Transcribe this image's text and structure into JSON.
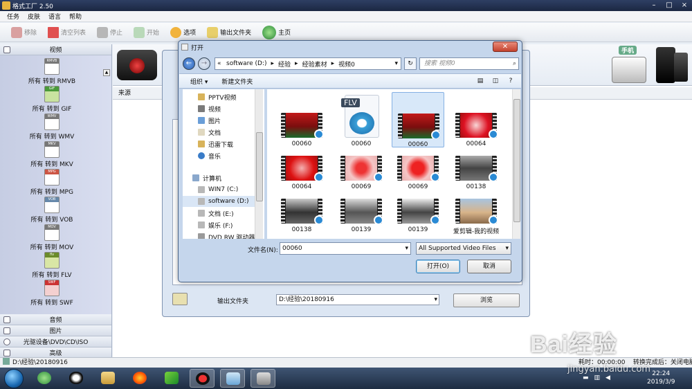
{
  "app": {
    "title": "格式工厂 2.50"
  },
  "colors": {
    "accent": "#2a5fb4",
    "title_bar": "#1b2742",
    "sidebar": "#c6cde3",
    "close": "#c4422e"
  },
  "menu": [
    "任务",
    "皮肤",
    "语言",
    "帮助"
  ],
  "toolbar": {
    "remove": "移除",
    "clear": "清空列表",
    "stop": "停止",
    "start": "开始",
    "options": "选项",
    "output_folder": "输出文件夹",
    "home": "主页"
  },
  "sidebar": {
    "video_header": "视频",
    "formats": [
      {
        "label": "所有 转到 RMVB",
        "tag": "RMVB"
      },
      {
        "label": "所有 转到 GIF",
        "tag": "GIF"
      },
      {
        "label": "所有 转到 WMV",
        "tag": "WMV"
      },
      {
        "label": "所有 转到 MKV",
        "tag": "MKV"
      },
      {
        "label": "所有 转到 MPG",
        "tag": "MPG"
      },
      {
        "label": "所有 转到 VOB",
        "tag": "VOB"
      },
      {
        "label": "所有 转到 MOV",
        "tag": "MOV"
      },
      {
        "label": "所有 转到 FLV",
        "tag": "flv"
      },
      {
        "label": "所有 转到 SWF",
        "tag": "SWF"
      }
    ],
    "audio": "音频",
    "image": "图片",
    "disc": "光驱设备\\DVD\\CD\\ISO",
    "advanced": "高级"
  },
  "main": {
    "source_header": "来源",
    "phone_label": "手机"
  },
  "bg_dialog": {
    "output_folder_label": "输出文件夹",
    "output_path": "D:\\经验\\20180916",
    "browse": "浏览"
  },
  "open_dialog": {
    "title": "打开",
    "path": [
      "software (D:)",
      "经验",
      "经验素材",
      "视频0"
    ],
    "search_placeholder": "搜索 视频0",
    "organize": "组织 ▾",
    "new_folder": "新建文件夹",
    "nav": {
      "favorites": [
        "PPTV视频",
        "视频",
        "图片",
        "文档",
        "迅雷下载",
        "音乐"
      ],
      "computer": "计算机",
      "drives": [
        "WIN7 (C:)",
        "software (D:)",
        "文档 (E:)",
        "娱乐 (F:)",
        "DVD RW 驱动器"
      ]
    },
    "files": [
      "00060",
      "00060",
      "00060",
      "00064",
      "00064",
      "00069",
      "00069",
      "00138",
      "00138",
      "00139",
      "00139",
      "爱剪辑-我的视频"
    ],
    "flv_badge": "FLV",
    "filename_label": "文件名(N):",
    "filename": "00060",
    "filetype": "All Supported Video Files",
    "open": "打开(O)",
    "cancel": "取消"
  },
  "statusbar": {
    "path": "D:\\经验\\20180916",
    "elapsed": "耗时：00:00:00",
    "after": "转换完成后：关闭电脑"
  },
  "taskbar": {
    "time": "22:24",
    "date": "2019/3/9"
  },
  "watermark": {
    "text": "Bai经验",
    "sub": "jingyan.baidu.com"
  }
}
